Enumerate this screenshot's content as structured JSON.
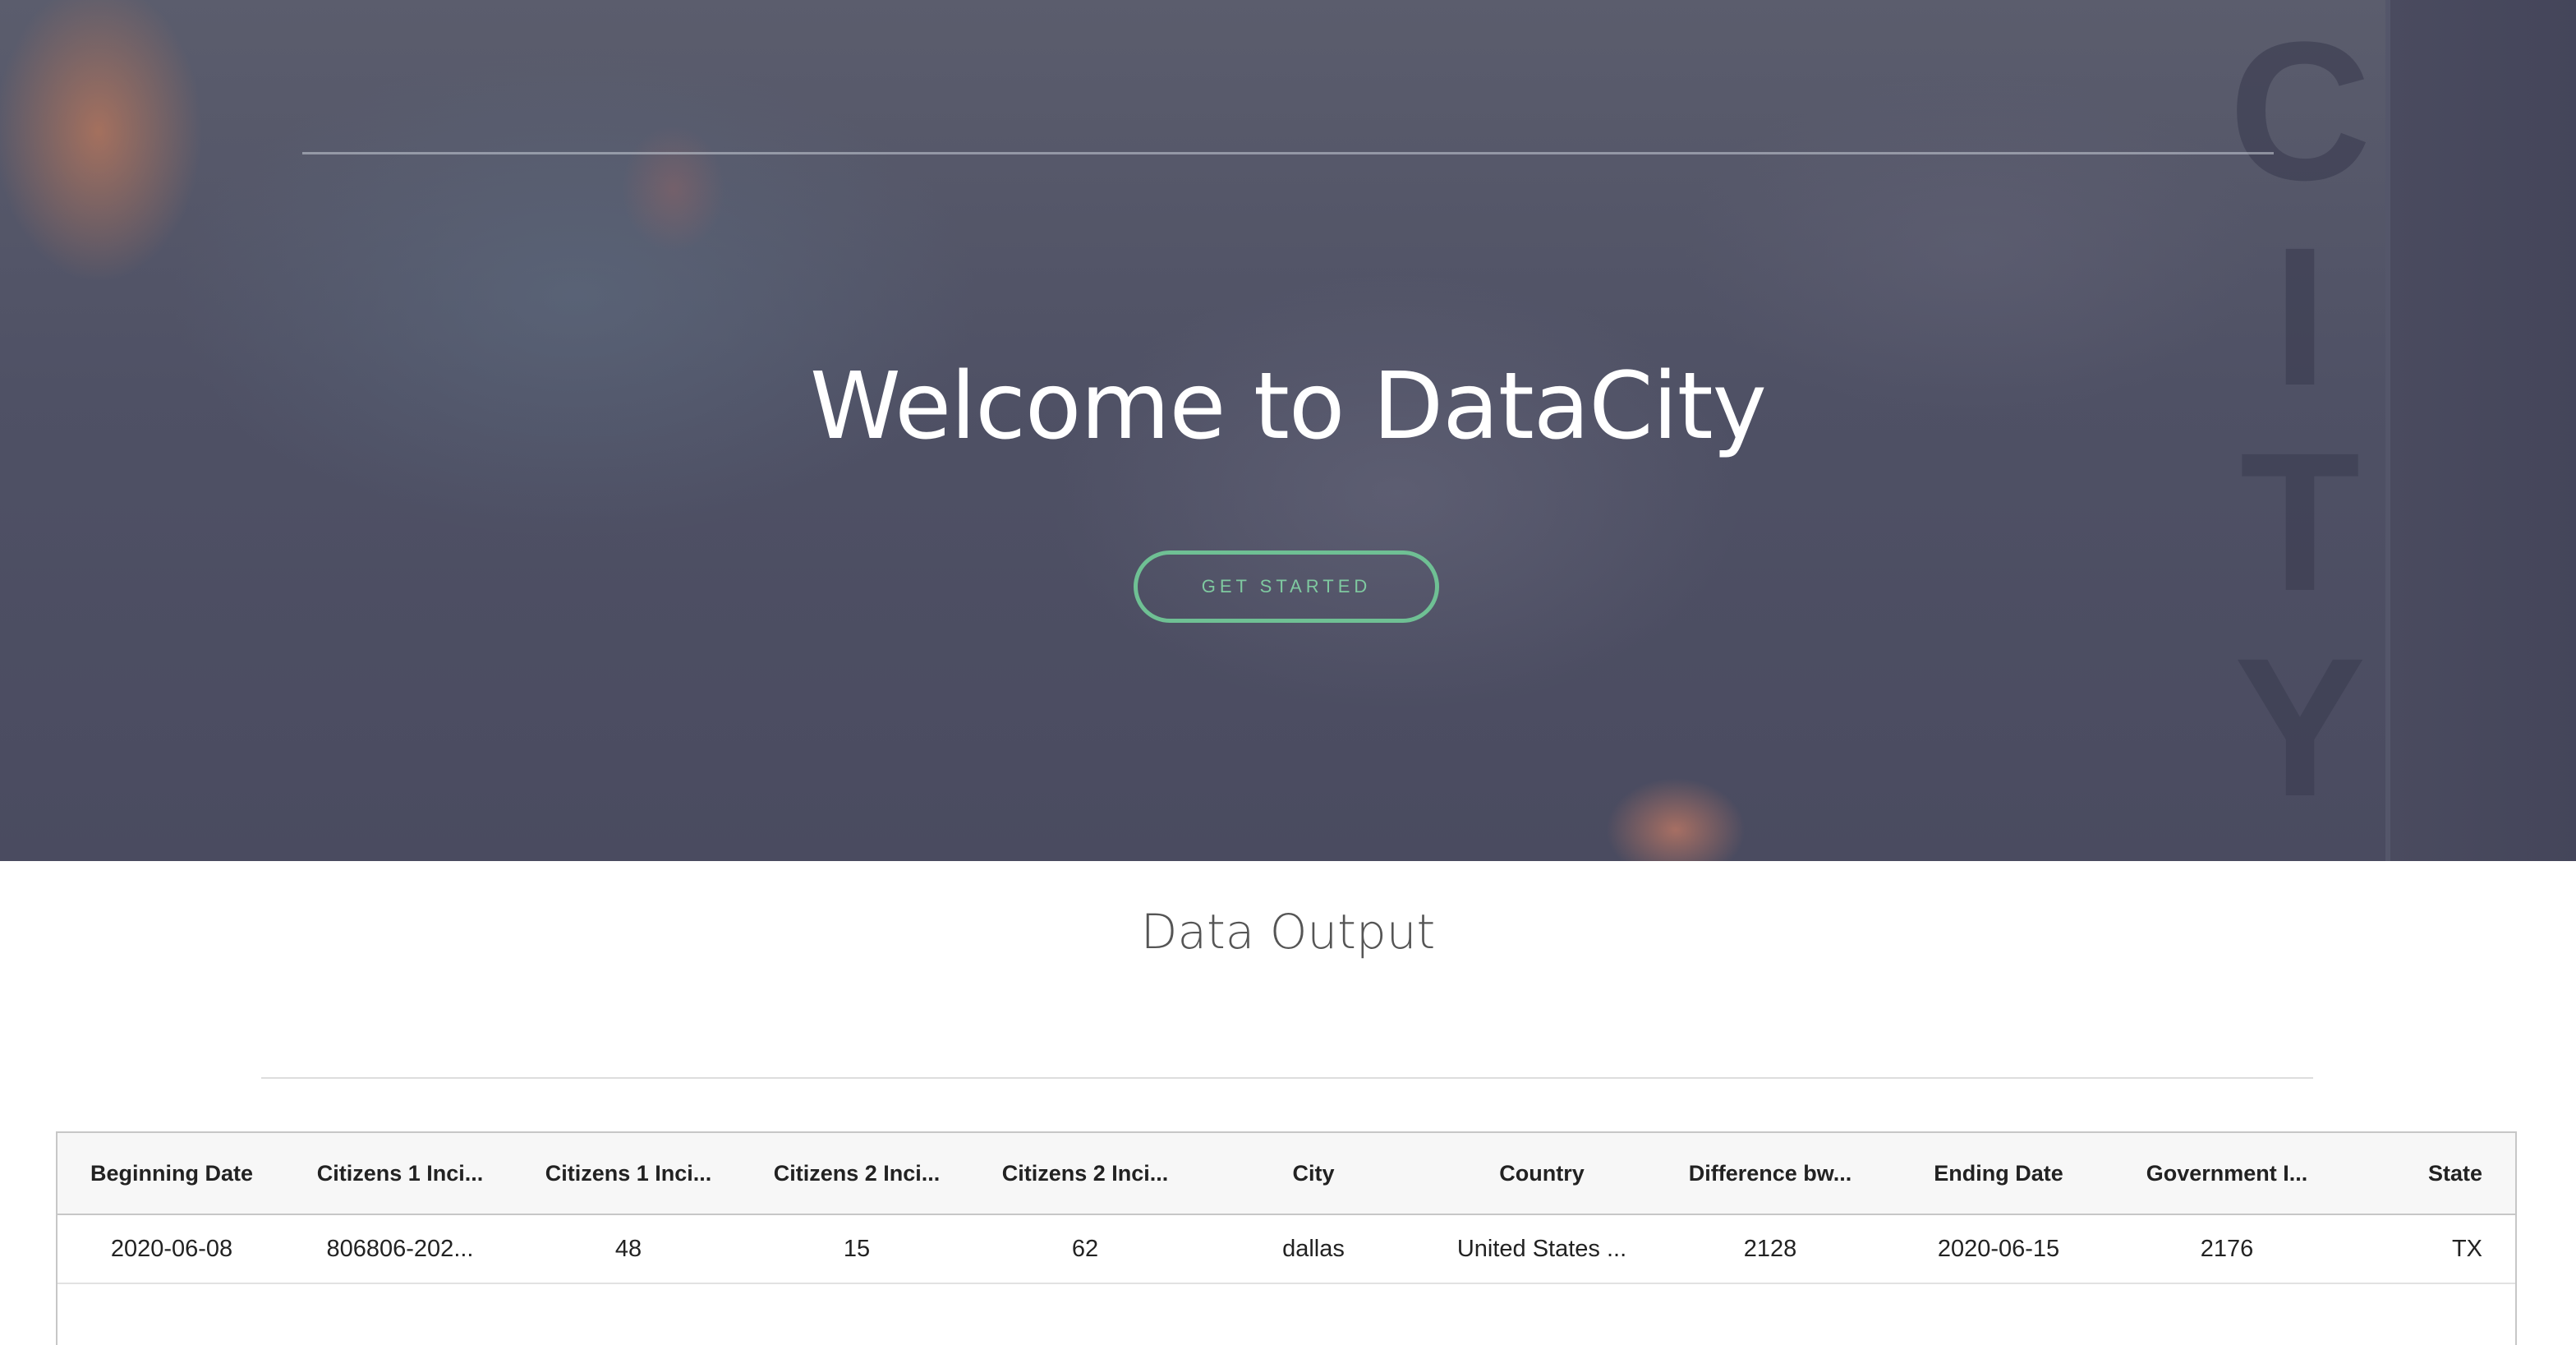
{
  "hero": {
    "title": "Welcome to DataCity",
    "button_label": "GET STARTED",
    "sign_letters": [
      "C",
      "I",
      "T",
      "Y"
    ]
  },
  "section": {
    "title": "Data Output"
  },
  "table": {
    "columns": [
      "Beginning Date",
      "Citizens 1 Inci...",
      "Citizens 1 Inci...",
      "Citizens 2 Inci...",
      "Citizens 2 Inci...",
      "City",
      "Country",
      "Difference bw...",
      "Ending Date",
      "Government I...",
      "State"
    ],
    "rows": [
      [
        "2020-06-08",
        "806806-202...",
        "48",
        "15",
        "62",
        "dallas",
        "United States ...",
        "2128",
        "2020-06-15",
        "2176",
        "TX"
      ]
    ]
  },
  "colors": {
    "accent": "#6fc094",
    "hero_overlay": "#4f5165",
    "title_text": "#555555"
  }
}
